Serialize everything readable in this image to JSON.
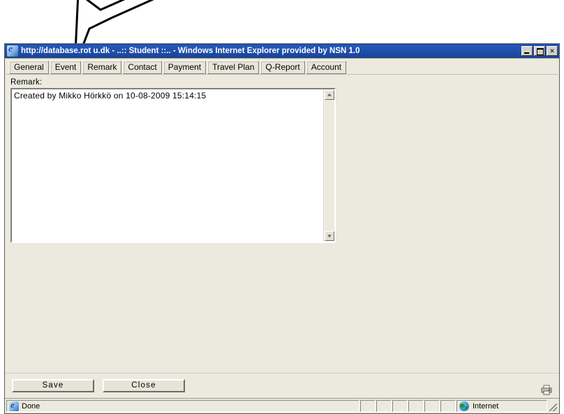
{
  "window": {
    "title": "http://database.rot        u.dk - ..:: Student ::.. - Windows Internet Explorer provided by NSN 1.0",
    "icon": "internet-explorer-icon",
    "controls": {
      "minimize": "_",
      "maximize": "□",
      "close": "✕"
    }
  },
  "tabs": [
    {
      "label": "General"
    },
    {
      "label": "Event"
    },
    {
      "label": "Remark"
    },
    {
      "label": "Contact"
    },
    {
      "label": "Payment"
    },
    {
      "label": "Travel Plan"
    },
    {
      "label": "Q-Report"
    },
    {
      "label": "Account"
    }
  ],
  "form": {
    "remark_label": "Remark:",
    "remark_value": "Created by Mikko Hörkkö on 10-08-2009 15:14:15",
    "save_label": "Save",
    "close_label": "Close",
    "print_icon": "printer-icon"
  },
  "scrollbar": {
    "up_icon": "scroll-up-arrow-icon",
    "down_icon": "scroll-down-arrow-icon"
  },
  "status_bar": {
    "message": "Done",
    "message_icon": "internet-explorer-icon",
    "zone": "Internet",
    "zone_icon": "globe-icon",
    "small_panes": [
      "",
      "",
      "",
      "",
      "",
      ""
    ]
  },
  "annotation": {
    "type": "arrow",
    "points_to": "Remark tab",
    "fill": "#ffffff",
    "stroke": "#000000"
  },
  "colors": {
    "title_bar": "#1f4fae",
    "page_background": "#eceade",
    "field_background": "#ffffff",
    "button_face": "#e6e4d8"
  }
}
